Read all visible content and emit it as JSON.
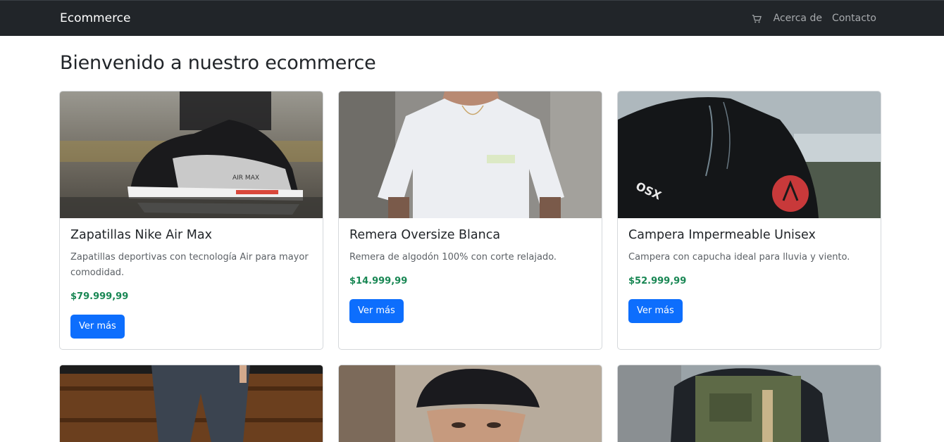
{
  "navbar": {
    "brand": "Ecommerce",
    "cart_icon": "cart-icon",
    "links": [
      "Acerca de",
      "Contacto"
    ]
  },
  "page": {
    "title": "Bienvenido a nuestro ecommerce"
  },
  "products": [
    {
      "title": "Zapatillas Nike Air Max",
      "description": "Zapatillas deportivas con tecnología Air para mayor comodidad.",
      "price": "$79.999,99",
      "button": "Ver más"
    },
    {
      "title": "Remera Oversize Blanca",
      "description": "Remera de algodón 100% con corte relajado.",
      "price": "$14.999,99",
      "button": "Ver más"
    },
    {
      "title": "Campera Impermeable Unisex",
      "description": "Campera con capucha ideal para lluvia y viento.",
      "price": "$52.999,99",
      "button": "Ver más"
    }
  ],
  "image_labels": {
    "shoe_logo": "AIR MAX",
    "jacket_logo": "OSX"
  },
  "colors": {
    "navbar": "#212529",
    "primary": "#0d6efd",
    "price": "#198754"
  }
}
